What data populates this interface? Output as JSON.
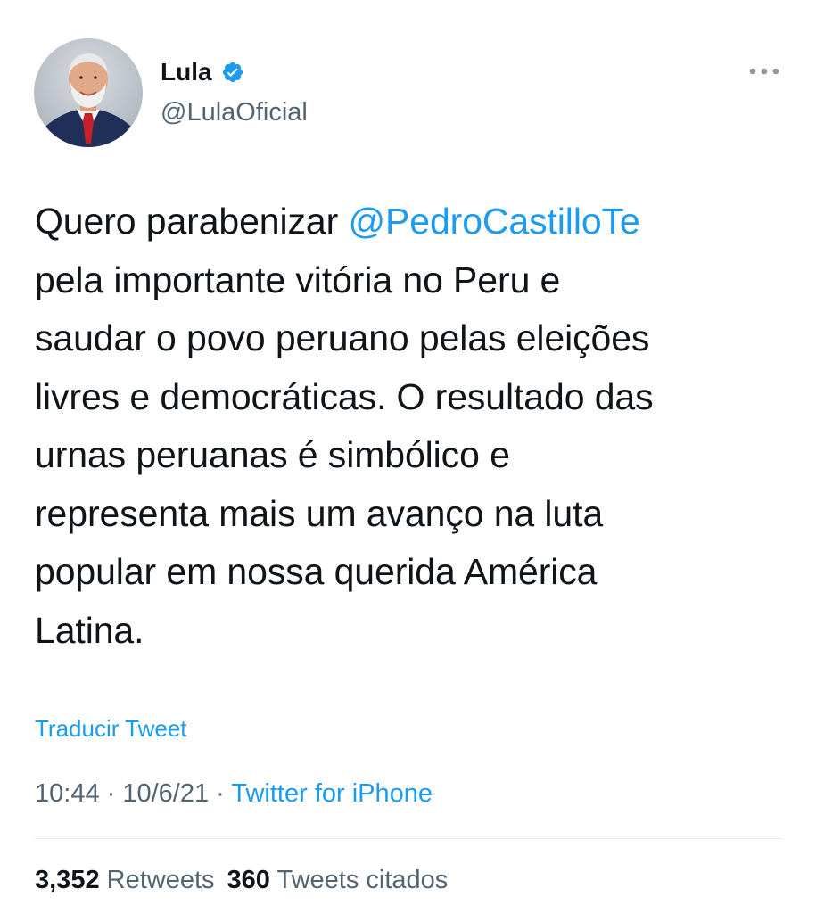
{
  "author": {
    "display_name": "Lula",
    "handle": "@LulaOficial",
    "verified": true,
    "verified_color": "#1d9bf0"
  },
  "tweet": {
    "lines": [
      {
        "pre": "Quero parabenizar ",
        "mention": "@PedroCastilloTe"
      },
      {
        "text": "pela importante vitória no Peru e"
      },
      {
        "text": "saudar o povo peruano pelas eleições"
      },
      {
        "text": "livres e democráticas. O resultado das"
      },
      {
        "text": "urnas peruanas é simbólico e"
      },
      {
        "text": "representa mais um avanço na luta"
      },
      {
        "text": "popular em nossa querida América"
      },
      {
        "text": "Latina."
      }
    ]
  },
  "translate_label": "Traducir Tweet",
  "meta": {
    "time": "10:44",
    "separator": " · ",
    "date": "10/6/21",
    "source": "Twitter for iPhone"
  },
  "stats": {
    "retweets_count": "3,352",
    "retweets_label": "Retweets",
    "quotes_count": "360",
    "quotes_label": "Tweets citados"
  },
  "icons": {
    "verified": "verified-badge-icon",
    "more": "more-options-icon",
    "avatar": "profile-avatar"
  },
  "colors": {
    "accent": "#1d9bf0",
    "text": "#0f1419",
    "secondary": "#536471"
  }
}
